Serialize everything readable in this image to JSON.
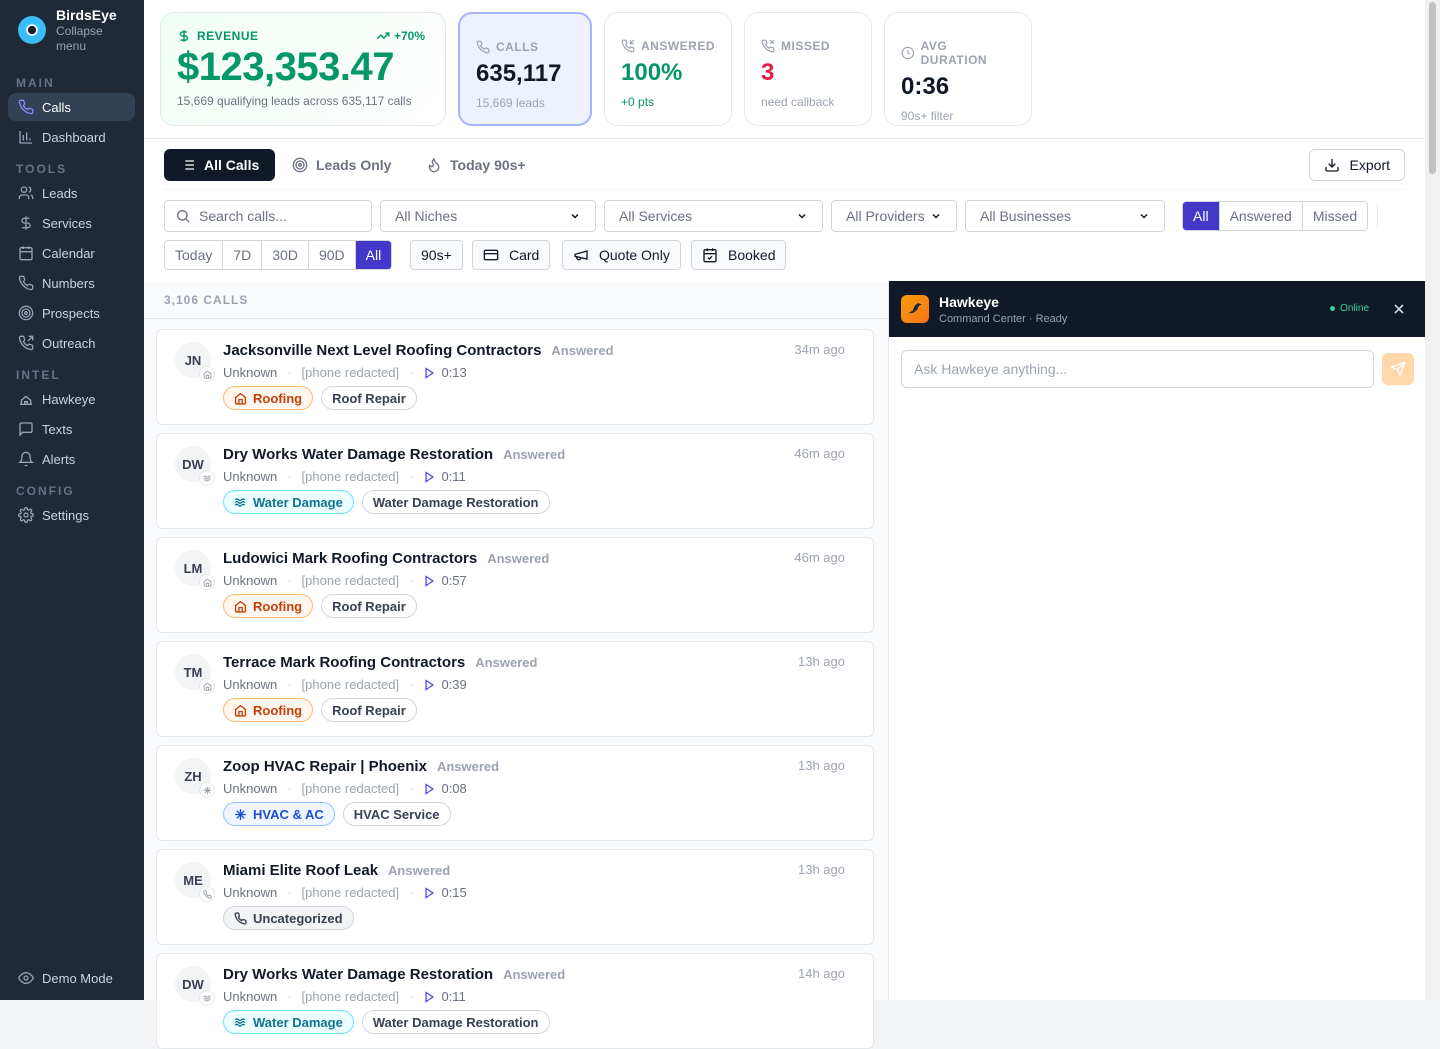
{
  "brand": {
    "name": "BirdsEye",
    "collapse": "Collapse menu"
  },
  "sidebar": {
    "sections": {
      "main": "MAIN",
      "tools": "TOOLS",
      "intel": "INTEL",
      "config": "CONFIG"
    },
    "items": [
      {
        "label": "Calls",
        "icon": "phone-icon",
        "active": true
      },
      {
        "label": "Dashboard",
        "icon": "bar-chart-icon"
      },
      {
        "label": "Leads",
        "icon": "users-icon"
      },
      {
        "label": "Services",
        "icon": "dollar-icon"
      },
      {
        "label": "Calendar",
        "icon": "calendar-icon"
      },
      {
        "label": "Numbers",
        "icon": "phone-icon"
      },
      {
        "label": "Prospects",
        "icon": "target-icon"
      },
      {
        "label": "Outreach",
        "icon": "phone-outgoing-icon"
      },
      {
        "label": "Hawkeye",
        "icon": "bird-icon"
      },
      {
        "label": "Texts",
        "icon": "message-icon"
      },
      {
        "label": "Alerts",
        "icon": "bell-icon"
      },
      {
        "label": "Settings",
        "icon": "gear-icon"
      }
    ],
    "demo": "Demo Mode"
  },
  "stats": {
    "revenue": {
      "label": "REVENUE",
      "value": "$123,353.47",
      "trend": "+70%",
      "sub": "15,669 qualifying leads across 635,117 calls"
    },
    "calls": {
      "label": "CALLS",
      "value": "635,117",
      "sub": "15,669 leads"
    },
    "answered": {
      "label": "ANSWERED",
      "value": "100%",
      "sub": "+0 pts"
    },
    "missed": {
      "label": "MISSED",
      "value": "3",
      "sub": "need callback"
    },
    "avg": {
      "label": "AVG DURATION",
      "value": "0:36",
      "sub": "90s+ filter"
    }
  },
  "colors": {
    "accent": "#4338ca",
    "revenue": "#059669",
    "missed": "#e11d48"
  },
  "tabs": [
    "All Calls",
    "Leads Only",
    "Today 90s+"
  ],
  "export": "Export",
  "filters": {
    "search_placeholder": "Search calls...",
    "niche": "All Niches",
    "services": "All Services",
    "providers": "All Providers",
    "businesses": "All Businesses",
    "status": [
      "All",
      "Answered",
      "Missed"
    ],
    "ranges": [
      "Today",
      "7D",
      "30D",
      "90D",
      "All"
    ],
    "p90": "90s+",
    "card": "Card",
    "quote": "Quote Only",
    "booked": "Booked"
  },
  "list": {
    "count": "3,106 CALLS",
    "items": [
      {
        "initials": "JN",
        "name": "Jacksonville Next Level Roofing Contractors",
        "status": "Answered",
        "time": "34m ago",
        "caller": "Unknown",
        "phone": "[phone redacted]",
        "dur": "0:13",
        "niche": "Roofing",
        "nicheType": "roof",
        "service": "Roof Repair"
      },
      {
        "initials": "DW",
        "name": "Dry Works Water Damage Restoration",
        "status": "Answered",
        "time": "46m ago",
        "caller": "Unknown",
        "phone": "[phone redacted]",
        "dur": "0:11",
        "niche": "Water Damage",
        "nicheType": "water",
        "service": "Water Damage Restoration"
      },
      {
        "initials": "LM",
        "name": "Ludowici Mark Roofing Contractors",
        "status": "Answered",
        "time": "46m ago",
        "caller": "Unknown",
        "phone": "[phone redacted]",
        "dur": "0:57",
        "niche": "Roofing",
        "nicheType": "roof",
        "service": "Roof Repair"
      },
      {
        "initials": "TM",
        "name": "Terrace Mark Roofing Contractors",
        "status": "Answered",
        "time": "13h ago",
        "caller": "Unknown",
        "phone": "[phone redacted]",
        "dur": "0:39",
        "niche": "Roofing",
        "nicheType": "roof",
        "service": "Roof Repair"
      },
      {
        "initials": "ZH",
        "name": "Zoop HVAC Repair | Phoenix",
        "status": "Answered",
        "time": "13h ago",
        "caller": "Unknown",
        "phone": "[phone redacted]",
        "dur": "0:08",
        "niche": "HVAC & AC",
        "nicheType": "hvac",
        "service": "HVAC Service"
      },
      {
        "initials": "ME",
        "name": "Miami Elite Roof Leak",
        "status": "Answered",
        "time": "13h ago",
        "caller": "Unknown",
        "phone": "[phone redacted]",
        "dur": "0:15",
        "niche": "Uncategorized",
        "nicheType": "unc",
        "service": ""
      },
      {
        "initials": "DW",
        "name": "Dry Works Water Damage Restoration",
        "status": "Answered",
        "time": "14h ago",
        "caller": "Unknown",
        "phone": "[phone redacted]",
        "dur": "0:11",
        "niche": "Water Damage",
        "nicheType": "water",
        "service": "Water Damage Restoration"
      }
    ]
  },
  "hawkeye": {
    "title": "Hawkeye",
    "subtitle": "Command Center · Ready",
    "status": "Online",
    "placeholder": "Ask Hawkeye anything..."
  }
}
